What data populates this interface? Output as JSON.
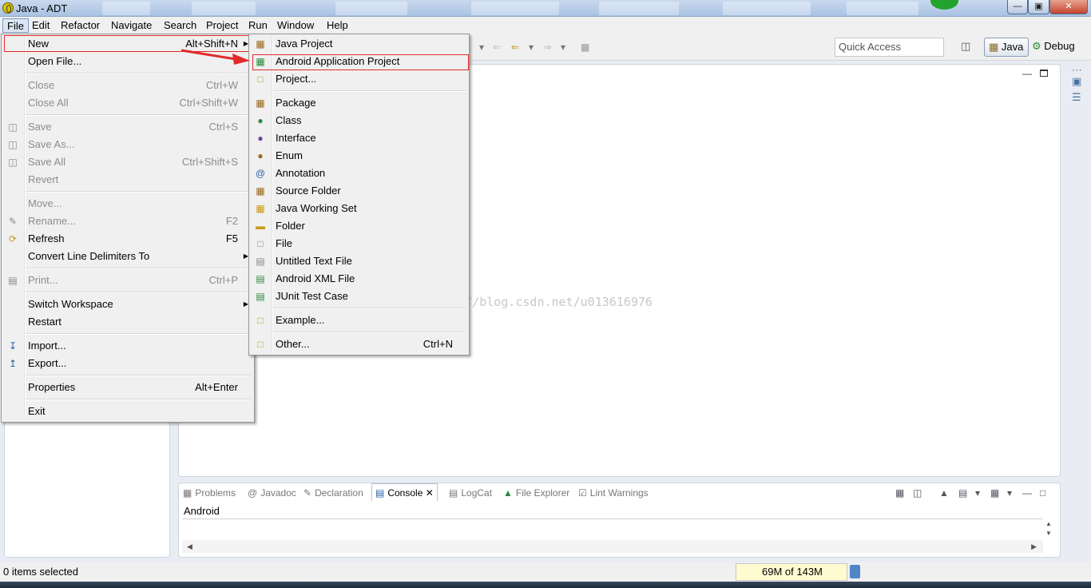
{
  "window": {
    "title": "Java - ADT"
  },
  "menubar": [
    "File",
    "Edit",
    "Refactor",
    "Navigate",
    "Search",
    "Project",
    "Run",
    "Window",
    "Help"
  ],
  "toolbar": {
    "quick_access_placeholder": "Quick Access",
    "perspective_java": "Java",
    "perspective_debug": "Debug"
  },
  "file_menu": [
    {
      "label": "New",
      "accel": "Alt+Shift+N",
      "submenu": true,
      "highlight": true
    },
    {
      "label": "Open File..."
    },
    {
      "label": "Close",
      "accel": "Ctrl+W",
      "disabled": true
    },
    {
      "label": "Close All",
      "accel": "Ctrl+Shift+W",
      "disabled": true
    },
    {
      "label": "Save",
      "accel": "Ctrl+S",
      "disabled": true
    },
    {
      "label": "Save As...",
      "disabled": true
    },
    {
      "label": "Save All",
      "accel": "Ctrl+Shift+S",
      "disabled": true
    },
    {
      "label": "Revert",
      "disabled": true
    },
    {
      "label": "Move...",
      "disabled": true
    },
    {
      "label": "Rename...",
      "accel": "F2",
      "disabled": true
    },
    {
      "label": "Refresh",
      "accel": "F5"
    },
    {
      "label": "Convert Line Delimiters To",
      "submenu": true
    },
    {
      "label": "Print...",
      "accel": "Ctrl+P",
      "disabled": true
    },
    {
      "label": "Switch Workspace",
      "submenu": true
    },
    {
      "label": "Restart"
    },
    {
      "label": "Import..."
    },
    {
      "label": "Export..."
    },
    {
      "label": "Properties",
      "accel": "Alt+Enter"
    },
    {
      "label": "Exit"
    }
  ],
  "new_menu": [
    {
      "label": "Java Project"
    },
    {
      "label": "Android Application Project",
      "highlight": true
    },
    {
      "label": "Project..."
    },
    {
      "label": "Package"
    },
    {
      "label": "Class"
    },
    {
      "label": "Interface"
    },
    {
      "label": "Enum"
    },
    {
      "label": "Annotation"
    },
    {
      "label": "Source Folder"
    },
    {
      "label": "Java Working Set"
    },
    {
      "label": "Folder"
    },
    {
      "label": "File"
    },
    {
      "label": "Untitled Text File"
    },
    {
      "label": "Android XML File"
    },
    {
      "label": "JUnit Test Case"
    },
    {
      "label": "Example..."
    },
    {
      "label": "Other...",
      "accel": "Ctrl+N"
    }
  ],
  "console_tabs": [
    "Problems",
    "Javadoc",
    "Declaration",
    "Console",
    "LogCat",
    "File Explorer",
    "Lint Warnings"
  ],
  "console": {
    "name": "Android"
  },
  "watermark": "http://blog.csdn.net/u013616976",
  "status": {
    "selection": "0 items selected",
    "heap": "69M of 143M"
  },
  "colors": {
    "highlight_border": "#e22a2a",
    "menu_bg": "#f0f0f0"
  }
}
